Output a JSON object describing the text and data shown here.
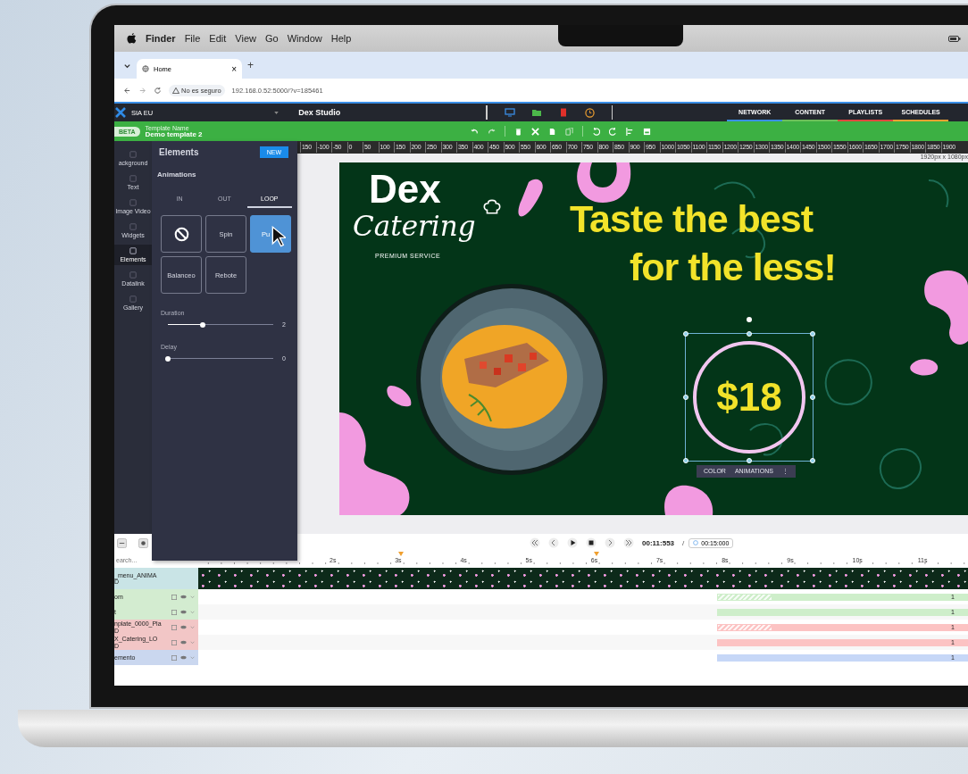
{
  "menubar": {
    "app": "Finder",
    "menus": [
      "File",
      "Edit",
      "View",
      "Go",
      "Window",
      "Help"
    ]
  },
  "browser": {
    "tab_title": "Home",
    "tab_close": "×",
    "new_tab": "+",
    "security": "No es seguro",
    "url": "192.168.0.52:5000/?v=185461"
  },
  "app_bar": {
    "workspace": "SIA EU",
    "title": "Dex Studio",
    "nav": [
      {
        "label": "NETWORK",
        "color": "#3a8ee6"
      },
      {
        "label": "CONTENT",
        "color": "#6cc05a"
      },
      {
        "label": "PLAYLISTS",
        "color": "#e0483e"
      },
      {
        "label": "SCHEDULES",
        "color": "#f0a030"
      }
    ]
  },
  "template_bar": {
    "badge": "BETA",
    "name_label": "Template Name",
    "name": "Demo template 2"
  },
  "rail": [
    {
      "label": "ackground",
      "selected": false
    },
    {
      "label": "Text",
      "selected": false
    },
    {
      "label": "Image Video",
      "selected": false
    },
    {
      "label": "Widgets",
      "selected": false
    },
    {
      "label": "Elements",
      "selected": true
    },
    {
      "label": "Datalink",
      "selected": false
    },
    {
      "label": "Gallery",
      "selected": false
    }
  ],
  "panel": {
    "title": "Elements",
    "new_button": "NEW",
    "section": "Animations",
    "tabs": [
      {
        "label": "IN",
        "selected": false
      },
      {
        "label": "OUT",
        "selected": false
      },
      {
        "label": "LOOP",
        "selected": true
      }
    ],
    "effects": [
      {
        "kind": "none",
        "selected": false
      },
      {
        "kind": "text",
        "label": "Spin",
        "selected": false
      },
      {
        "kind": "text",
        "label": "Pu",
        "selected": true
      },
      {
        "kind": "text",
        "label": "Balanceo",
        "selected": false
      },
      {
        "kind": "text",
        "label": "Rebote",
        "selected": false
      }
    ],
    "sliders": [
      {
        "label": "Duration",
        "level": 0.33,
        "reading": "2"
      },
      {
        "label": "Delay",
        "level": 0,
        "reading": "0"
      }
    ]
  },
  "ruler": {
    "marks": [
      "150",
      "-100",
      "-50",
      "0",
      "50",
      "100",
      "150",
      "200",
      "250",
      "300",
      "350",
      "400",
      "450",
      "500",
      "550",
      "600",
      "650",
      "700",
      "750",
      "800",
      "850",
      "900",
      "950",
      "1000",
      "1050",
      "1100",
      "1150",
      "1200",
      "1250",
      "1300",
      "1350",
      "1400",
      "1450",
      "1500",
      "1550",
      "1600",
      "1650",
      "1700",
      "1750",
      "1800",
      "1850",
      "1900"
    ],
    "size": "1920px x 1080px"
  },
  "design": {
    "logo_word": "Dex",
    "logo_script": "Catering",
    "logo_tagline": "PREMIUM SERVICE",
    "headline": [
      "Taste the best",
      "for the less!"
    ],
    "price": "$18",
    "toolbar": [
      "COLOR",
      "ANIMATIONS",
      "⋮"
    ]
  },
  "timeline": {
    "search_placeholder": "earch...",
    "time": "00:11:553",
    "separator": "/",
    "duration": "00:15:000",
    "ticks": [
      "2s",
      "3s",
      "4s",
      "5s",
      "6s",
      "7s",
      "8s",
      "9s",
      "10s",
      "11s"
    ],
    "tracks": [
      {
        "lines": [
          "_menu_ANIMA",
          "D"
        ],
        "kind": "film",
        "color": "#c9e4e6"
      },
      {
        "lines": [
          "om"
        ],
        "kind": "bar",
        "color": "#d3ecd0",
        "hatched": true,
        "reading": "1"
      },
      {
        "lines": [
          "t"
        ],
        "kind": "bar",
        "color": "#d3ecd0",
        "hatched": false,
        "reading": "1"
      },
      {
        "lines": [
          "nplate_0000_Pla",
          "D"
        ],
        "kind": "bar",
        "color": "#f2c6c6",
        "hatched": true,
        "reading": "1"
      },
      {
        "lines": [
          "X_Catering_LO",
          "D"
        ],
        "kind": "bar",
        "color": "#f2c6c6",
        "hatched": false,
        "reading": "1"
      },
      {
        "lines": [
          "emento"
        ],
        "kind": "bar",
        "color": "#cad7ef",
        "hatched": false,
        "reading": "1"
      }
    ]
  }
}
